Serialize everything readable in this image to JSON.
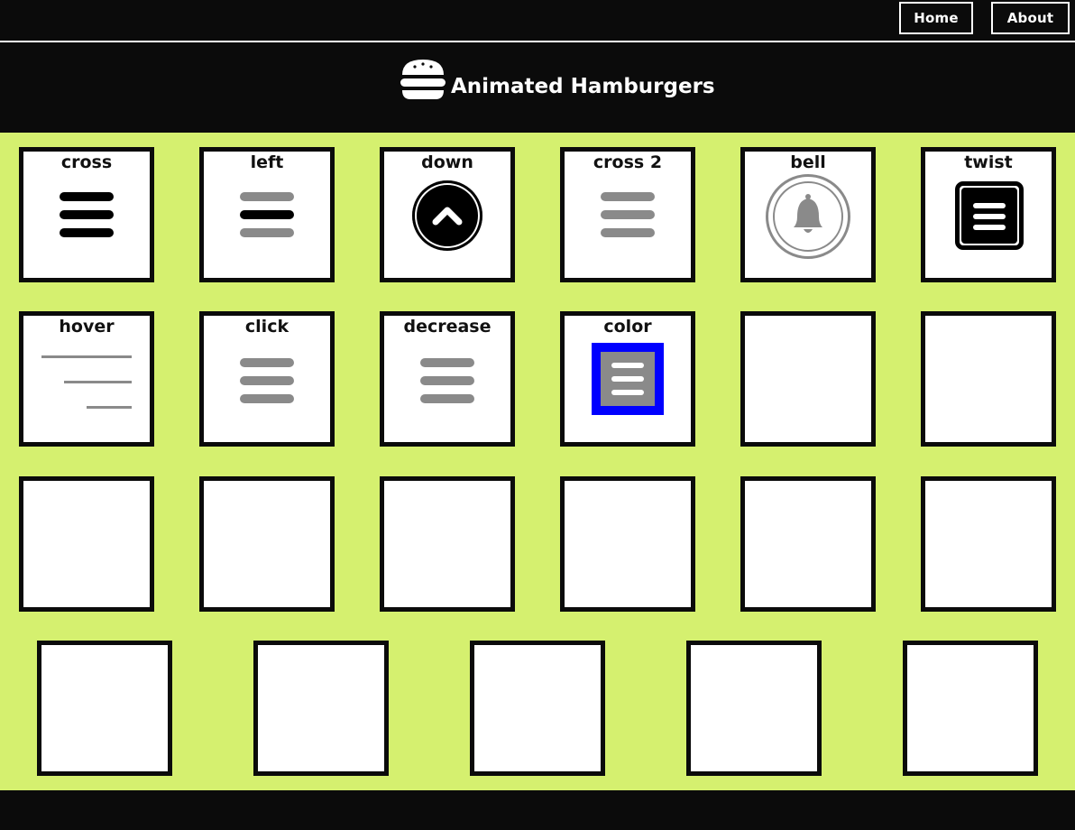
{
  "nav": {
    "home_label": "Home",
    "about_label": "About"
  },
  "header": {
    "title": "Animated Hamburgers",
    "logo_icon": "hamburger-logo-icon"
  },
  "colors": {
    "background": "#d5f06f",
    "dark": "#0b0b0b",
    "gray": "#8a8a8a",
    "blue": "#0000ff"
  },
  "cards": [
    {
      "label": "cross",
      "icon": "hamburger-icon"
    },
    {
      "label": "left",
      "icon": "hamburger-icon"
    },
    {
      "label": "down",
      "icon": "chevron-up-icon"
    },
    {
      "label": "cross 2",
      "icon": "hamburger-icon"
    },
    {
      "label": "bell",
      "icon": "bell-icon"
    },
    {
      "label": "twist",
      "icon": "hamburger-icon"
    },
    {
      "label": "hover",
      "icon": "hamburger-icon"
    },
    {
      "label": "click",
      "icon": "hamburger-icon"
    },
    {
      "label": "decrease",
      "icon": "hamburger-icon"
    },
    {
      "label": "color",
      "icon": "hamburger-icon"
    }
  ]
}
